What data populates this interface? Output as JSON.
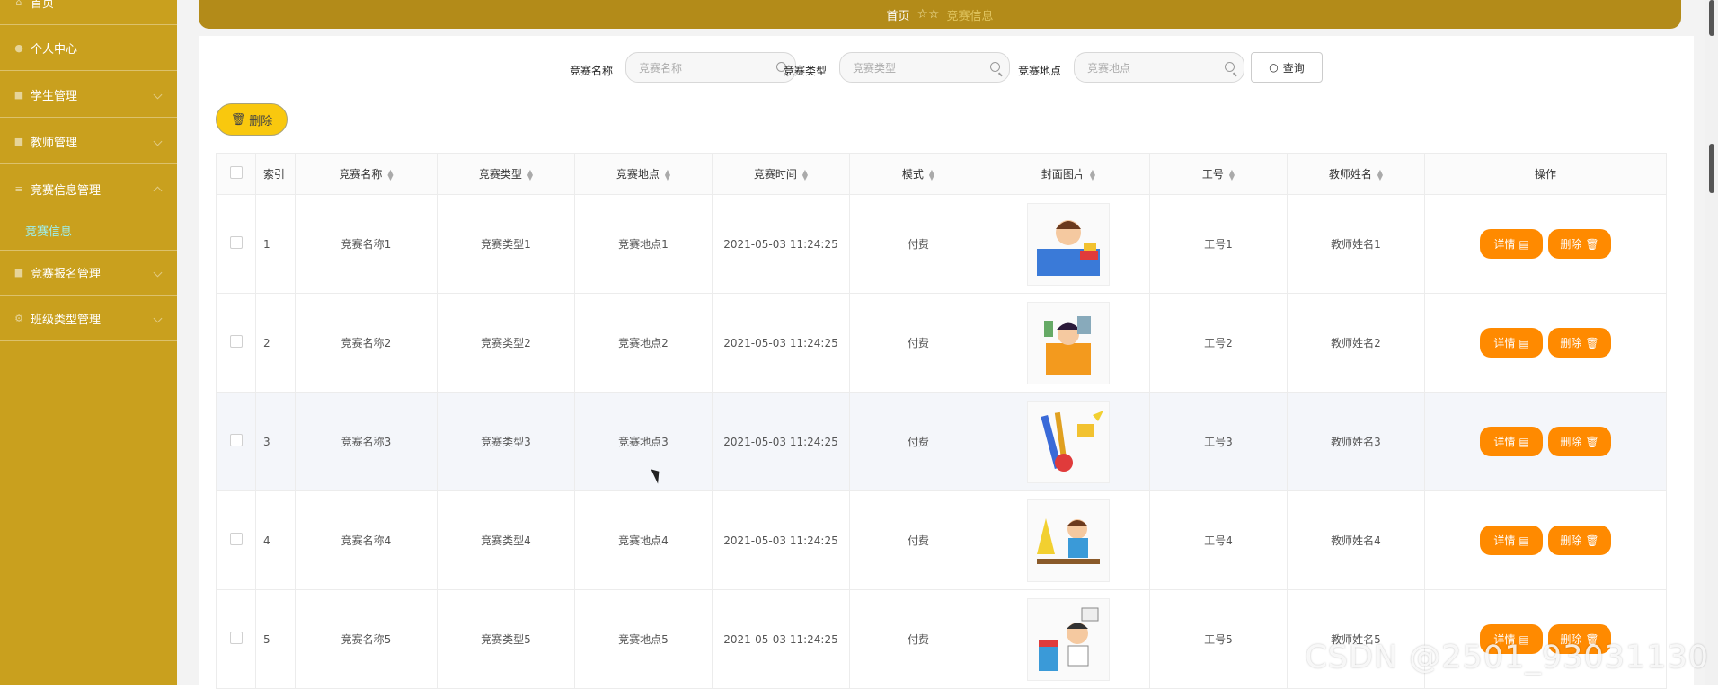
{
  "sidebar": {
    "items": [
      {
        "label": "首页"
      },
      {
        "label": "个人中心"
      },
      {
        "label": "学生管理"
      },
      {
        "label": "教师管理"
      },
      {
        "label": "竞赛信息管理"
      },
      {
        "label": "竞赛报名管理"
      },
      {
        "label": "班级类型管理"
      }
    ],
    "subitem": {
      "label": "竞赛信息"
    }
  },
  "breadcrumb": {
    "home": "首页",
    "current": "竞赛信息"
  },
  "search": {
    "name_label": "竞赛名称",
    "name_placeholder": "竞赛名称",
    "type_label": "竞赛类型",
    "type_placeholder": "竞赛类型",
    "place_label": "竞赛地点",
    "place_placeholder": "竞赛地点",
    "query_label": "查询"
  },
  "toolbar": {
    "delete_label": "删除"
  },
  "table": {
    "headers": [
      "索引",
      "竞赛名称",
      "竞赛类型",
      "竞赛地点",
      "竞赛时间",
      "模式",
      "封面图片",
      "工号",
      "教师姓名",
      "操作"
    ],
    "rows": [
      {
        "idx": "1",
        "name": "竞赛名称1",
        "type": "竞赛类型1",
        "place": "竞赛地点1",
        "time": "2021-05-03 11:24:25",
        "mode": "付费",
        "no": "工号1",
        "teacher": "教师姓名1"
      },
      {
        "idx": "2",
        "name": "竞赛名称2",
        "type": "竞赛类型2",
        "place": "竞赛地点2",
        "time": "2021-05-03 11:24:25",
        "mode": "付费",
        "no": "工号2",
        "teacher": "教师姓名2"
      },
      {
        "idx": "3",
        "name": "竞赛名称3",
        "type": "竞赛类型3",
        "place": "竞赛地点3",
        "time": "2021-05-03 11:24:25",
        "mode": "付费",
        "no": "工号3",
        "teacher": "教师姓名3"
      },
      {
        "idx": "4",
        "name": "竞赛名称4",
        "type": "竞赛类型4",
        "place": "竞赛地点4",
        "time": "2021-05-03 11:24:25",
        "mode": "付费",
        "no": "工号4",
        "teacher": "教师姓名4"
      },
      {
        "idx": "5",
        "name": "竞赛名称5",
        "type": "竞赛类型5",
        "place": "竞赛地点5",
        "time": "2021-05-03 11:24:25",
        "mode": "付费",
        "no": "工号5",
        "teacher": "教师姓名5"
      }
    ],
    "actions": {
      "detail": "详情",
      "delete": "删除"
    }
  },
  "watermark": "CSDN @2501_93031130",
  "colors": {
    "sidebar": "#c9a01e",
    "breadcrumb_bar": "#b38b19",
    "action_button": "#ff8a00",
    "bulk_delete": "#f9c80e"
  }
}
